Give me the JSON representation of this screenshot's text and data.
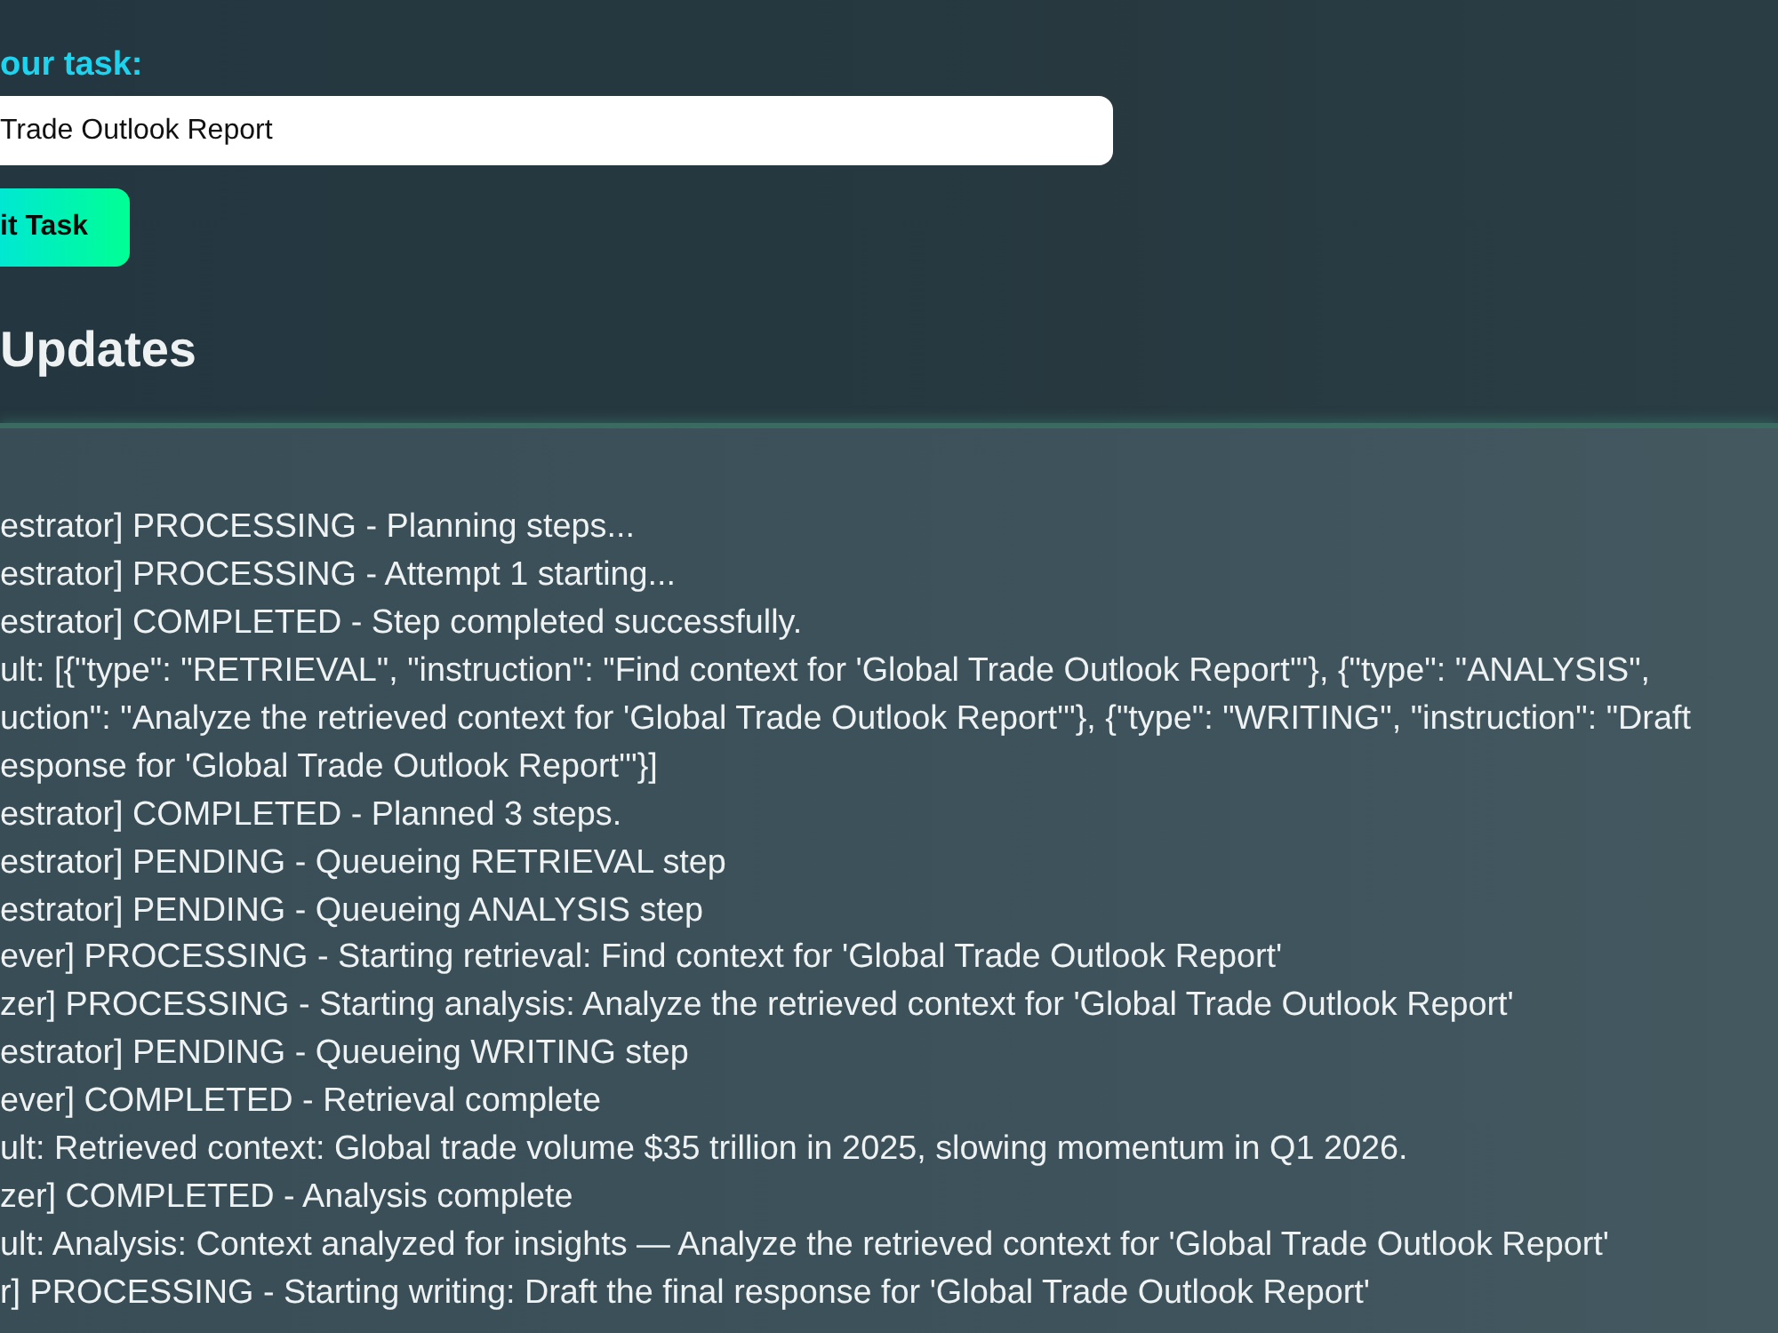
{
  "task_form": {
    "label": "our task:",
    "input": {
      "value": "Trade Outlook Report"
    },
    "submit_button": "it Task"
  },
  "updates": {
    "heading": "Updates",
    "lines": [
      "estrator] PROCESSING - Planning steps...",
      "estrator] PROCESSING - Attempt 1 starting...",
      "estrator] COMPLETED - Step completed successfully.",
      "ult: [{\"type\": \"RETRIEVAL\", \"instruction\": \"Find context for 'Global Trade Outlook Report'\"}, {\"type\": \"ANALYSIS\",",
      "uction\": \"Analyze the retrieved context for 'Global Trade Outlook Report'\"}, {\"type\": \"WRITING\", \"instruction\": \"Draft",
      "esponse for 'Global Trade Outlook Report'\"}]",
      "estrator] COMPLETED - Planned 3 steps.",
      "estrator] PENDING - Queueing RETRIEVAL step",
      "estrator] PENDING - Queueing ANALYSIS step",
      "ever] PROCESSING - Starting retrieval: Find context for 'Global Trade Outlook Report'",
      "zer] PROCESSING - Starting analysis: Analyze the retrieved context for 'Global Trade Outlook Report'",
      "estrator] PENDING - Queueing WRITING step",
      "ever] COMPLETED - Retrieval complete",
      "ult: Retrieved context: Global trade volume $35 trillion in 2025, slowing momentum in Q1 2026.",
      "zer] COMPLETED - Analysis complete",
      "ult: Analysis: Context analyzed for insights — Analyze the retrieved context for 'Global Trade Outlook Report'",
      "r] PROCESSING - Starting writing: Draft the final response for 'Global Trade Outlook Report'"
    ]
  }
}
